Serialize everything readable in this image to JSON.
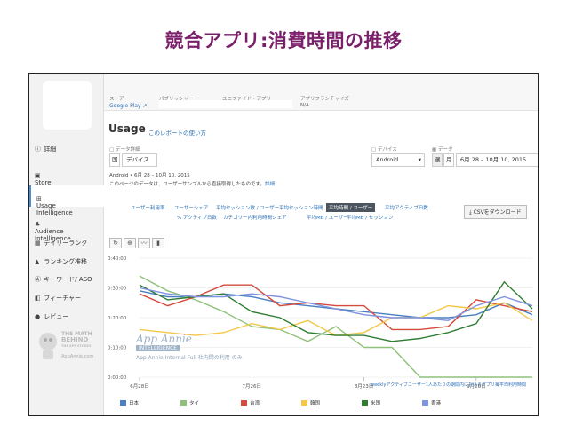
{
  "slide": {
    "title": "競合アプリ:消費時間の推移"
  },
  "sidebar": {
    "items": [
      {
        "icon": "ⓘ",
        "label": "詳細"
      },
      {
        "icon": "▣",
        "label": "Store\nIntelligence"
      },
      {
        "icon": "⊞",
        "label": "Usage\nIntelligence"
      },
      {
        "icon": "♣",
        "label": "Audience\nIntelligence"
      },
      {
        "icon": "▦",
        "label": "デイリーランク"
      },
      {
        "icon": "▲",
        "label": "ランキング推移"
      },
      {
        "icon": "Ⓐ",
        "label": "キーワード/ ASO"
      },
      {
        "icon": "◧",
        "label": "フィーチャー"
      },
      {
        "icon": "●",
        "label": "レビュー"
      }
    ],
    "logo": {
      "line1": "THE MATH",
      "line2": "BEHIND",
      "line3": "THE APP STORES",
      "line4": "AppAnnie.com"
    }
  },
  "topbar": {
    "store_label": "ストア",
    "store_value": "Google Play",
    "publisher_label": "パブリッシャー",
    "unified_label": "ユニファイド・アプリ",
    "franchise_label": "アプリフランチャイズ",
    "franchise_value": "N/A"
  },
  "page": {
    "title": "Usage",
    "howto_link": "このレポートの使い方"
  },
  "filters": {
    "data_label": "データ詳細",
    "country_value": "国",
    "device_value": "デバイス",
    "device_label": "デバイス",
    "device_select": "Android",
    "date_label": "データ",
    "week": "週",
    "month": "月",
    "date_range": "6月 28 – 10月 10, 2015",
    "summary": "Android • 6月 28 – 10月 10, 2015",
    "note": "このページのデータは、ユーザーサンプルから直接取得したものです。",
    "note_link": "詳細"
  },
  "metrics": {
    "row1": [
      "ユーザー利用率",
      "ユーザーシェア",
      "平均セッション数 / ユーザー",
      "平均セッション時間",
      "平均時間 / ユーザー",
      "平均アクティブ日数"
    ],
    "row2": [
      "% アクティブ日数",
      "カテゴリー内利用時間シェア",
      "平均MB / ユーザー",
      "平均MB / セッション"
    ],
    "active": "平均時間 / ユーザー",
    "csv_button": "CSVをダウンロード"
  },
  "tools": [
    "↻",
    "⊕",
    "〰",
    "▮"
  ],
  "watermark": {
    "brand": "App Annie",
    "sub": "INTELLIGENCE",
    "note": "App Annie Internal Full 社内間の利用 のみ"
  },
  "chart_data": {
    "type": "line",
    "x": [
      "6月28日",
      "7月5日",
      "7月12日",
      "7月19日",
      "7月26日",
      "8月2日",
      "8月9日",
      "8月16日",
      "8月23日",
      "8月30日",
      "9月6日",
      "9月13日",
      "9月20日",
      "9月27日",
      "10月4日"
    ],
    "x_tick_labels": [
      "6月28日",
      "7月26日",
      "8月23日",
      "9月20日"
    ],
    "y_tick_labels": [
      "0:40:00",
      "0:30:00",
      "0:20:00",
      "0:10:00",
      "0:00:00"
    ],
    "ylim_minutes": [
      0,
      40
    ],
    "footer_label": "weeklyアクティブユーザー1人あたりの期間内におけるアプリ毎平均利用時間",
    "series": [
      {
        "name": "日本",
        "color": "#4a7fc1",
        "values": [
          29,
          27,
          27,
          28,
          27,
          25,
          24,
          23,
          22,
          21,
          20,
          20,
          21,
          25,
          21
        ]
      },
      {
        "name": "タイ",
        "color": "#8fc17b",
        "values": [
          34,
          29,
          26,
          22,
          17,
          16,
          12,
          17,
          10,
          10,
          0,
          0,
          0,
          0,
          0
        ]
      },
      {
        "name": "台湾",
        "color": "#d44a3c",
        "values": [
          28,
          24,
          27,
          31,
          31,
          24,
          25,
          24,
          24,
          16,
          16,
          17,
          26,
          24,
          22
        ]
      },
      {
        "name": "韓国",
        "color": "#f2c84b",
        "values": [
          16,
          15,
          14,
          15,
          18,
          16,
          19,
          14,
          15,
          20,
          20,
          24,
          23,
          25,
          19
        ]
      },
      {
        "name": "米国",
        "color": "#2f7d32",
        "values": [
          31,
          26,
          27,
          28,
          22,
          20,
          15,
          14,
          14,
          12,
          13,
          15,
          18,
          32,
          23
        ]
      },
      {
        "name": "香港",
        "color": "#7f93e0",
        "values": [
          30,
          28,
          27,
          27,
          28,
          27,
          25,
          23,
          21,
          20,
          20,
          19,
          24,
          27,
          24
        ]
      }
    ]
  }
}
